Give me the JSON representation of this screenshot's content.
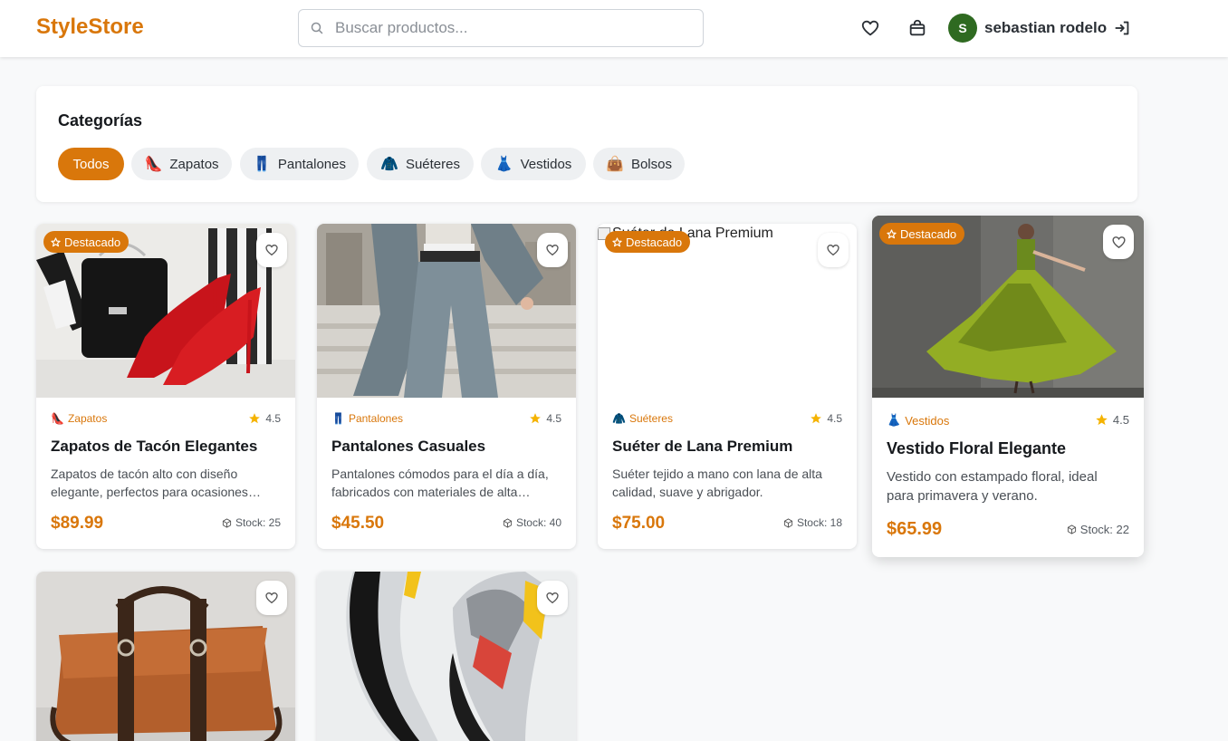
{
  "header": {
    "logo": "StyleStore",
    "search_placeholder": "Buscar productos...",
    "user_initial": "S",
    "user_name": "sebastian rodelo",
    "icons": [
      "heart-icon",
      "shopping-bag-icon",
      "logout-icon",
      "search-icon"
    ]
  },
  "categories": {
    "title": "Categorías",
    "items": [
      {
        "label": "Todos",
        "emoji": "",
        "active": true
      },
      {
        "label": "Zapatos",
        "emoji": "👠",
        "active": false
      },
      {
        "label": "Pantalones",
        "emoji": "👖",
        "active": false
      },
      {
        "label": "Suéteres",
        "emoji": "🧥",
        "active": false
      },
      {
        "label": "Vestidos",
        "emoji": "👗",
        "active": false
      },
      {
        "label": "Bolsos",
        "emoji": "👜",
        "active": false
      }
    ]
  },
  "badge_label": "Destacado",
  "products": [
    {
      "category": "Zapatos",
      "emoji": "👠",
      "rating": "4.5",
      "title": "Zapatos de Tacón Elegantes",
      "desc": "Zapatos de tacón alto con diseño elegante, perfectos para ocasiones especiales.",
      "price": "$89.99",
      "stock": "Stock: 25",
      "featured": true
    },
    {
      "category": "Pantalones",
      "emoji": "👖",
      "rating": "4.5",
      "title": "Pantalones Casuales",
      "desc": "Pantalones cómodos para el día a día, fabricados con materiales de alta calidad.",
      "price": "$45.50",
      "stock": "Stock: 40",
      "featured": false
    },
    {
      "category": "Suéteres",
      "emoji": "🧥",
      "rating": "4.5",
      "title": "Suéter de Lana Premium",
      "desc": "Suéter tejido a mano con lana de alta calidad, suave y abrigador.",
      "price": "$75.00",
      "stock": "Stock: 18",
      "featured": true,
      "image_alt": "Suéter de Lana Premium"
    },
    {
      "category": "Vestidos",
      "emoji": "👗",
      "rating": "4.5",
      "title": "Vestido Floral Elegante",
      "desc": "Vestido con estampado floral, ideal para primavera y verano.",
      "price": "$65.99",
      "stock": "Stock: 22",
      "featured": true
    }
  ],
  "colors": {
    "accent": "#d9770b",
    "avatar": "#2f6a21",
    "star": "#f5b301"
  }
}
